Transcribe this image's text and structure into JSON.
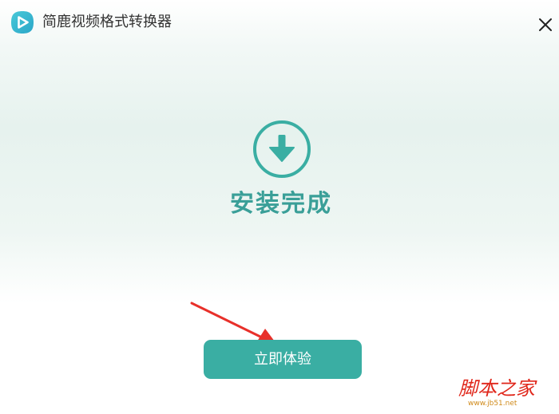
{
  "window": {
    "title": "简鹿视频格式转换器",
    "close_icon": "close-icon",
    "logo_icon": "play-logo-icon"
  },
  "status": {
    "icon": "download-arrow-icon",
    "text": "安装完成"
  },
  "actions": {
    "primary_label": "立即体验"
  },
  "annotation": {
    "icon": "red-pointer-arrow-icon"
  },
  "watermark": {
    "main": "脚本之家",
    "sub": "www.jb51.net"
  },
  "colors": {
    "accent": "#3aaea3",
    "status_text": "#3a9f98",
    "annotation": "#e8302a",
    "watermark": "#e0261a"
  }
}
